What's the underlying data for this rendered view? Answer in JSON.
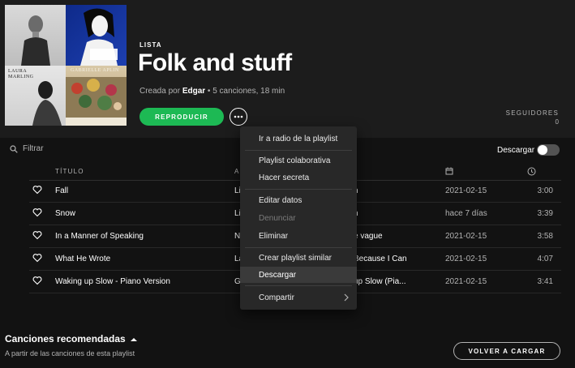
{
  "playlist": {
    "type_label": "LISTA",
    "title": "Folk and stuff",
    "created_prefix": "Creada por",
    "owner": "Edgar",
    "details": " • 5 canciones, 18 min",
    "play_label": "REPRODUCIR",
    "more_label": "•••",
    "followers_label": "SEGUIDORES",
    "followers_count": "0"
  },
  "cover": {
    "tiles": [
      {
        "caption": ""
      },
      {
        "caption": ""
      },
      {
        "caption": "LAURA\nMARLING"
      },
      {
        "caption": "GABRIELLE APLIN"
      }
    ]
  },
  "filter": {
    "placeholder": "Filtrar"
  },
  "download": {
    "label": "Descargar",
    "enabled": false
  },
  "table": {
    "headers": {
      "title": "TÍTULO",
      "artist": "A",
      "date_icon": "calendar-icon",
      "duration_icon": "clock-icon"
    },
    "rows": [
      {
        "title": "Fall",
        "artist": "Li",
        "album": "n",
        "date": "2021-02-15",
        "duration": "3:00"
      },
      {
        "title": "Snow",
        "artist": "Li",
        "album": "n",
        "date": "hace 7 días",
        "duration": "3:39"
      },
      {
        "title": "In a Manner of Speaking",
        "artist": "N",
        "album": "e vague",
        "date": "2021-02-15",
        "duration": "3:58"
      },
      {
        "title": "What He Wrote",
        "artist": "La",
        "album": "Because I Can",
        "date": "2021-02-15",
        "duration": "4:07"
      },
      {
        "title": "Waking up Slow - Piano Version",
        "artist": "G",
        "album": "up Slow (Pia...",
        "date": "2021-02-15",
        "duration": "3:41"
      }
    ]
  },
  "context_menu": {
    "items": [
      {
        "label": "Ir a radio de la playlist",
        "disabled": false
      },
      {
        "label": "Playlist colaborativa",
        "disabled": false
      },
      {
        "label": "Hacer secreta",
        "disabled": false
      },
      {
        "label": "Editar datos",
        "disabled": false
      },
      {
        "label": "Denunciar",
        "disabled": true
      },
      {
        "label": "Eliminar",
        "disabled": false
      },
      {
        "label": "Crear playlist similar",
        "disabled": false
      },
      {
        "label": "Descargar",
        "disabled": false,
        "highlighted": true
      },
      {
        "label": "Compartir",
        "disabled": false,
        "submenu": true
      }
    ]
  },
  "recommended": {
    "title": "Canciones recomendadas",
    "subtitle": "A partir de las canciones de esta playlist",
    "reload_label": "VOLVER A CARGAR"
  },
  "colors": {
    "accent": "#1db954",
    "background": "#121212",
    "menu": "#282828"
  }
}
